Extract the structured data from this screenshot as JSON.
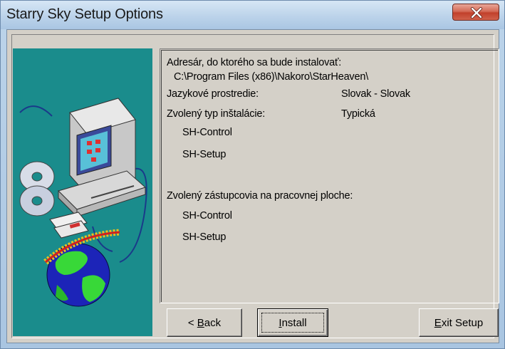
{
  "window": {
    "title": "Starry Sky Setup Options",
    "close_icon": "close-icon",
    "title_bar_color": "#bcd3ea",
    "close_button_color": "#c1402b",
    "client_background": "#d4d0c8",
    "side_panel_color": "#1a8c8c"
  },
  "summary": {
    "install_dir_label": "Adresár, do ktorého sa bude instalovať:",
    "install_dir_value": "C:\\Program Files (x86)\\Nakoro\\StarHeaven\\",
    "language_label": "Jazykové prostredie:",
    "language_value": "Slovak - Slovak",
    "install_type_label": "Zvolený typ inštalácie:",
    "install_type_value": "Typická",
    "components": [
      "SH-Control",
      "SH-Setup"
    ],
    "shortcuts_label": "Zvolený zástupcovia na pracovnej ploche:",
    "shortcuts": [
      "SH-Control",
      "SH-Setup"
    ]
  },
  "buttons": {
    "back": {
      "prefix": "< ",
      "mnemonic": "B",
      "rest": "ack"
    },
    "install": {
      "mnemonic": "I",
      "rest": "nstall"
    },
    "exit": {
      "mnemonic": "E",
      "rest": "xit Setup"
    }
  },
  "side_image": {
    "icons": [
      "computer-icon",
      "cd-disc-icon",
      "floppy-disk-icon",
      "globe-icon"
    ]
  }
}
